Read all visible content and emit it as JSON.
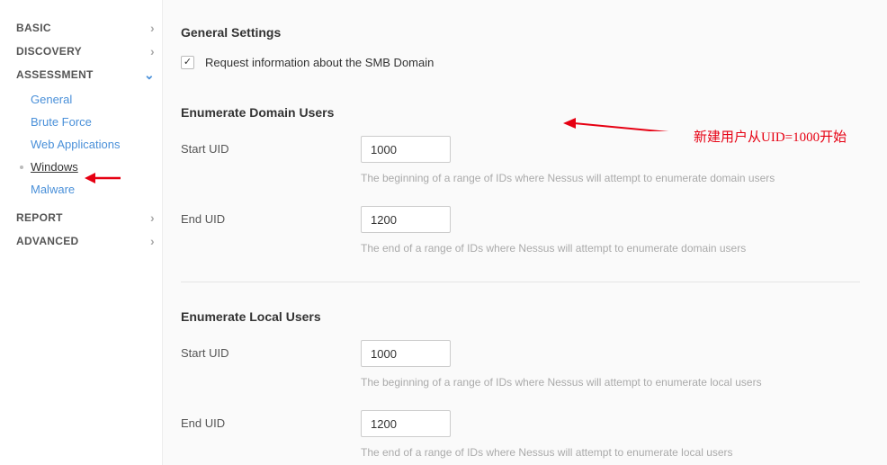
{
  "sidebar": {
    "sections": [
      {
        "label": "BASIC",
        "expanded": false
      },
      {
        "label": "DISCOVERY",
        "expanded": false
      },
      {
        "label": "ASSESSMENT",
        "expanded": true,
        "items": [
          {
            "label": "General"
          },
          {
            "label": "Brute Force"
          },
          {
            "label": "Web Applications"
          },
          {
            "label": "Windows",
            "active": true
          },
          {
            "label": "Malware"
          }
        ]
      },
      {
        "label": "REPORT",
        "expanded": false
      },
      {
        "label": "ADVANCED",
        "expanded": false
      }
    ]
  },
  "main": {
    "general": {
      "title": "General Settings",
      "smb_checked": true,
      "smb_label": "Request information about the SMB Domain"
    },
    "domain": {
      "title": "Enumerate Domain Users",
      "start_label": "Start UID",
      "start_value": "1000",
      "start_help": "The beginning of a range of IDs where Nessus will attempt to enumerate domain users",
      "end_label": "End UID",
      "end_value": "1200",
      "end_help": "The end of a range of IDs where Nessus will attempt to enumerate domain users"
    },
    "local": {
      "title": "Enumerate Local Users",
      "start_label": "Start UID",
      "start_value": "1000",
      "start_help": "The beginning of a range of IDs where Nessus will attempt to enumerate local users",
      "end_label": "End UID",
      "end_value": "1200",
      "end_help": "The end of a range of IDs where Nessus will attempt to enumerate local users"
    }
  },
  "annotations": {
    "note1": "新建用户从UID=1000开始"
  }
}
